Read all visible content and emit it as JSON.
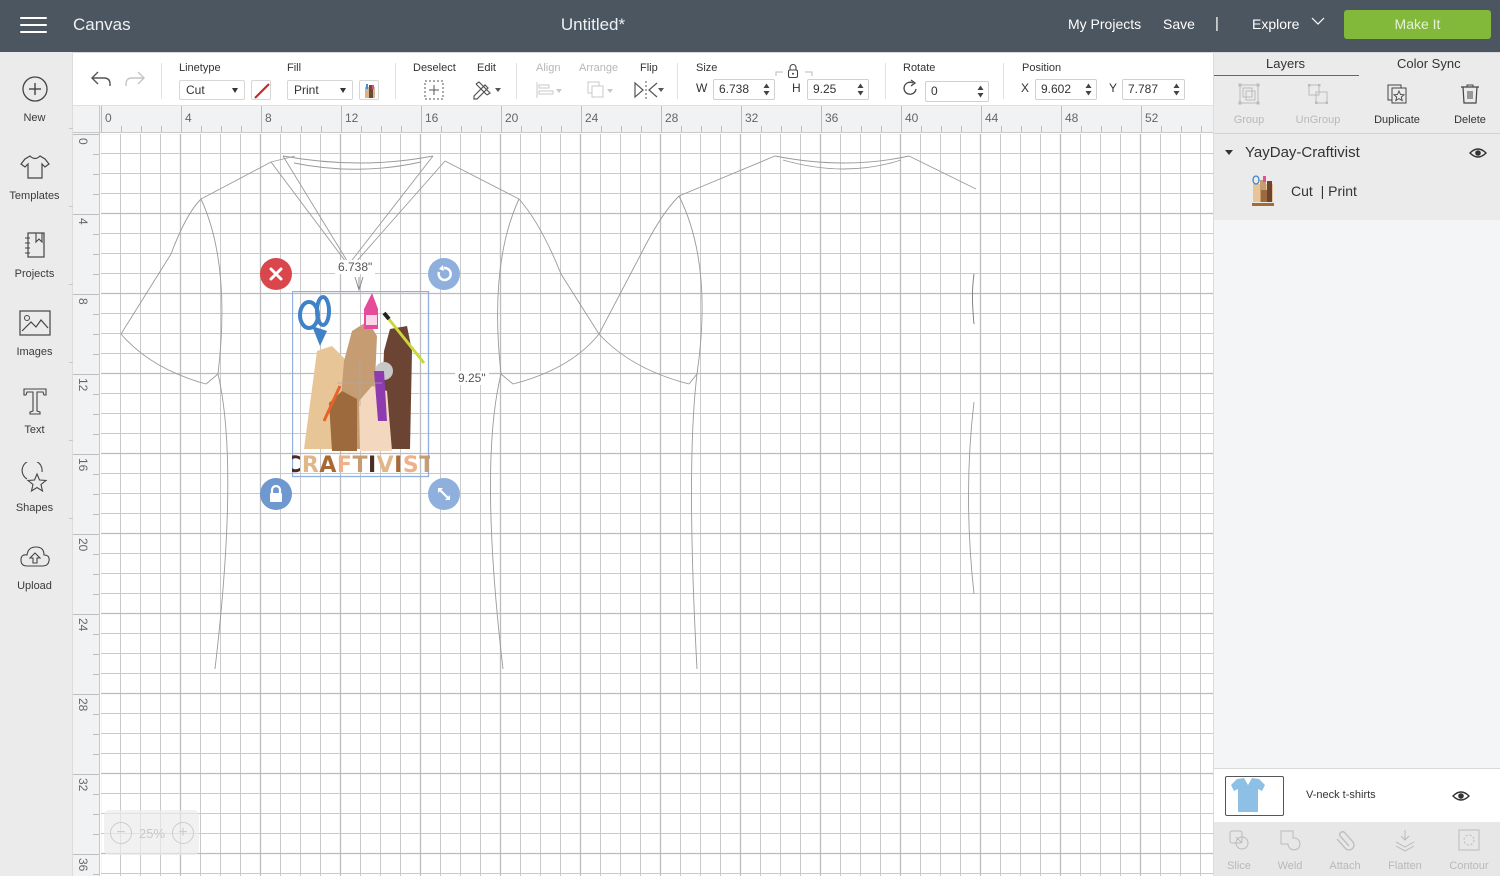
{
  "header": {
    "app_title": "Canvas",
    "document_title": "Untitled*",
    "my_projects": "My Projects",
    "save": "Save",
    "separator": "|",
    "explore": "Explore",
    "make_it": "Make It",
    "make_it_color": "#82b93a"
  },
  "sidebar": {
    "items": [
      {
        "label": "New",
        "icon": "plus-circle-icon"
      },
      {
        "label": "Templates",
        "icon": "tshirt-icon"
      },
      {
        "label": "Projects",
        "icon": "notebook-icon"
      },
      {
        "label": "Images",
        "icon": "image-icon"
      },
      {
        "label": "Text",
        "icon": "text-t-icon"
      },
      {
        "label": "Shapes",
        "icon": "shapes-icon"
      },
      {
        "label": "Upload",
        "icon": "cloud-upload-icon"
      }
    ]
  },
  "toolbar": {
    "undo": "undo-icon",
    "redo": "redo-icon",
    "linetype_label": "Linetype",
    "linetype_value": "Cut",
    "fill_label": "Fill",
    "fill_value": "Print",
    "deselect_label": "Deselect",
    "edit_label": "Edit",
    "align_label": "Align",
    "arrange_label": "Arrange",
    "flip_label": "Flip",
    "size_label": "Size",
    "w_label": "W",
    "w_value": "6.738",
    "h_label": "H",
    "h_value": "9.25",
    "rotate_label": "Rotate",
    "rotate_value": "0",
    "position_label": "Position",
    "x_label": "X",
    "x_value": "9.602",
    "y_label": "Y",
    "y_value": "7.787"
  },
  "rulers": {
    "top": [
      "0",
      "4",
      "8",
      "12",
      "16",
      "20",
      "24",
      "28",
      "32",
      "36",
      "40",
      "44",
      "48",
      "52"
    ],
    "left": [
      "0",
      "4",
      "8",
      "12",
      "16",
      "20",
      "24",
      "28",
      "32",
      "36"
    ]
  },
  "canvas": {
    "selection": {
      "width_label": "6.738\"",
      "height_label": "9.25\"",
      "image_text": "CRAFTIVIST"
    },
    "zoom": {
      "value": "25%",
      "minus": "−",
      "plus": "+"
    }
  },
  "panel": {
    "tabs": [
      {
        "label": "Layers",
        "active": true
      },
      {
        "label": "Color Sync",
        "active": false
      }
    ],
    "actions": [
      {
        "label": "Group",
        "enabled": false
      },
      {
        "label": "UnGroup",
        "enabled": false
      },
      {
        "label": "Duplicate",
        "enabled": true
      },
      {
        "label": "Delete",
        "enabled": true
      }
    ],
    "group": {
      "name": "YayDay-Craftivist",
      "visible": true,
      "layer": {
        "linetype": "Cut",
        "separator": "|",
        "fill": "Print"
      }
    },
    "template": {
      "name": "V-neck t-shirts",
      "visible": true
    },
    "bottom_actions": [
      {
        "label": "Slice",
        "enabled": false
      },
      {
        "label": "Weld",
        "enabled": false
      },
      {
        "label": "Attach",
        "enabled": false
      },
      {
        "label": "Flatten",
        "enabled": false
      },
      {
        "label": "Contour",
        "enabled": false
      }
    ]
  },
  "colors": {
    "header_bg": "#4c5660",
    "selection_blue": "#8fb0dc",
    "delete_red": "#d9474c",
    "panel_bg": "#f4f5f7"
  }
}
